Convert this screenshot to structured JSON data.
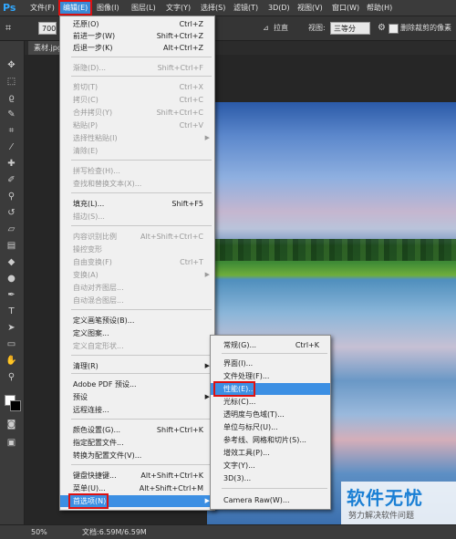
{
  "app": {
    "logo": "Ps"
  },
  "menubar": {
    "items": [
      {
        "label": "文件(F)"
      },
      {
        "label": "编辑(E)"
      },
      {
        "label": "图像(I)"
      },
      {
        "label": "图层(L)"
      },
      {
        "label": "文字(Y)"
      },
      {
        "label": "选择(S)"
      },
      {
        "label": "滤镜(T)"
      },
      {
        "label": "3D(D)"
      },
      {
        "label": "视图(V)"
      },
      {
        "label": "窗口(W)"
      },
      {
        "label": "帮助(H)"
      }
    ]
  },
  "options_bar": {
    "crop_icon": "crop-icon",
    "preset_value": "700",
    "straighten_label": "拉直",
    "view_label": "视图:",
    "view_value": "三等分",
    "delete_pixels_label": "删除裁剪的像素"
  },
  "document": {
    "tab_label": "素材.jpg"
  },
  "status": {
    "zoom": "50%",
    "doc_info": "文档:6.59M/6.59M"
  },
  "edit_menu": {
    "items": [
      {
        "label": "还原(O)",
        "shortcut": "Ctrl+Z",
        "disabled": false
      },
      {
        "label": "前进一步(W)",
        "shortcut": "Shift+Ctrl+Z",
        "disabled": false
      },
      {
        "label": "后退一步(K)",
        "shortcut": "Alt+Ctrl+Z",
        "disabled": false
      },
      {
        "label": "渐隐(D)...",
        "shortcut": "Shift+Ctrl+F",
        "disabled": true
      },
      {
        "label": "剪切(T)",
        "shortcut": "Ctrl+X",
        "disabled": true
      },
      {
        "label": "拷贝(C)",
        "shortcut": "Ctrl+C",
        "disabled": true
      },
      {
        "label": "合并拷贝(Y)",
        "shortcut": "Shift+Ctrl+C",
        "disabled": true
      },
      {
        "label": "粘贴(P)",
        "shortcut": "Ctrl+V",
        "disabled": true
      },
      {
        "label": "选择性粘贴(I)",
        "shortcut": "",
        "disabled": true,
        "submenu": true
      },
      {
        "label": "清除(E)",
        "shortcut": "",
        "disabled": true
      },
      {
        "label": "拼写检查(H)...",
        "shortcut": "",
        "disabled": true
      },
      {
        "label": "查找和替换文本(X)...",
        "shortcut": "",
        "disabled": true
      },
      {
        "label": "填充(L)...",
        "shortcut": "Shift+F5",
        "disabled": false
      },
      {
        "label": "描边(S)...",
        "shortcut": "",
        "disabled": true
      },
      {
        "label": "内容识别比例",
        "shortcut": "Alt+Shift+Ctrl+C",
        "disabled": true
      },
      {
        "label": "操控变形",
        "shortcut": "",
        "disabled": true
      },
      {
        "label": "自由变换(F)",
        "shortcut": "Ctrl+T",
        "disabled": true
      },
      {
        "label": "变换(A)",
        "shortcut": "",
        "disabled": true,
        "submenu": true
      },
      {
        "label": "自动对齐图层...",
        "shortcut": "",
        "disabled": true
      },
      {
        "label": "自动混合图层...",
        "shortcut": "",
        "disabled": true
      },
      {
        "label": "定义画笔预设(B)...",
        "shortcut": "",
        "disabled": false
      },
      {
        "label": "定义图案...",
        "shortcut": "",
        "disabled": false
      },
      {
        "label": "定义自定形状...",
        "shortcut": "",
        "disabled": true
      },
      {
        "label": "清理(R)",
        "shortcut": "",
        "disabled": false,
        "submenu": true
      },
      {
        "label": "Adobe PDF 预设...",
        "shortcut": "",
        "disabled": false
      },
      {
        "label": "预设",
        "shortcut": "",
        "disabled": false,
        "submenu": true
      },
      {
        "label": "远程连接...",
        "shortcut": "",
        "disabled": false
      },
      {
        "label": "颜色设置(G)...",
        "shortcut": "Shift+Ctrl+K",
        "disabled": false
      },
      {
        "label": "指定配置文件...",
        "shortcut": "",
        "disabled": false
      },
      {
        "label": "转换为配置文件(V)...",
        "shortcut": "",
        "disabled": false
      },
      {
        "label": "键盘快捷键...",
        "shortcut": "Alt+Shift+Ctrl+K",
        "disabled": false
      },
      {
        "label": "菜单(U)...",
        "shortcut": "Alt+Shift+Ctrl+M",
        "disabled": false
      },
      {
        "label": "首选项(N)",
        "shortcut": "",
        "disabled": false,
        "submenu": true,
        "highlight": true
      }
    ]
  },
  "preferences_submenu": {
    "items": [
      {
        "label": "常规(G)...",
        "shortcut": "Ctrl+K"
      },
      {
        "label": "界面(I)...",
        "shortcut": ""
      },
      {
        "label": "文件处理(F)...",
        "shortcut": ""
      },
      {
        "label": "性能(E)...",
        "shortcut": "",
        "highlight": true
      },
      {
        "label": "光标(C)...",
        "shortcut": ""
      },
      {
        "label": "透明度与色域(T)...",
        "shortcut": ""
      },
      {
        "label": "单位与标尺(U)...",
        "shortcut": ""
      },
      {
        "label": "参考线、网格和切片(S)...",
        "shortcut": ""
      },
      {
        "label": "增效工具(P)...",
        "shortcut": ""
      },
      {
        "label": "文字(Y)...",
        "shortcut": ""
      },
      {
        "label": "3D(3)...",
        "shortcut": ""
      },
      {
        "label": "Camera Raw(W)...",
        "shortcut": ""
      }
    ]
  },
  "watermark": {
    "title": "软件无忧",
    "subtitle": "努力解决软件问题"
  },
  "colors": {
    "accent": "#3c8fe3",
    "highlight_border": "#dd1111",
    "ps_blue": "#31a8ff"
  }
}
